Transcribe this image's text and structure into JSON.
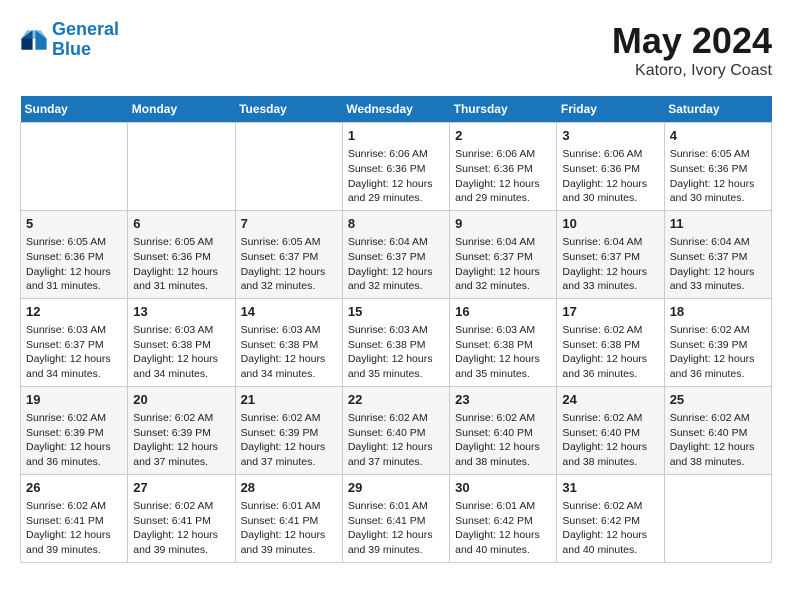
{
  "header": {
    "logo_line1": "General",
    "logo_line2": "Blue",
    "month": "May 2024",
    "location": "Katoro, Ivory Coast"
  },
  "weekdays": [
    "Sunday",
    "Monday",
    "Tuesday",
    "Wednesday",
    "Thursday",
    "Friday",
    "Saturday"
  ],
  "weeks": [
    [
      {
        "day": "",
        "info": ""
      },
      {
        "day": "",
        "info": ""
      },
      {
        "day": "",
        "info": ""
      },
      {
        "day": "1",
        "info": "Sunrise: 6:06 AM\nSunset: 6:36 PM\nDaylight: 12 hours and 29 minutes."
      },
      {
        "day": "2",
        "info": "Sunrise: 6:06 AM\nSunset: 6:36 PM\nDaylight: 12 hours and 29 minutes."
      },
      {
        "day": "3",
        "info": "Sunrise: 6:06 AM\nSunset: 6:36 PM\nDaylight: 12 hours and 30 minutes."
      },
      {
        "day": "4",
        "info": "Sunrise: 6:05 AM\nSunset: 6:36 PM\nDaylight: 12 hours and 30 minutes."
      }
    ],
    [
      {
        "day": "5",
        "info": "Sunrise: 6:05 AM\nSunset: 6:36 PM\nDaylight: 12 hours and 31 minutes."
      },
      {
        "day": "6",
        "info": "Sunrise: 6:05 AM\nSunset: 6:36 PM\nDaylight: 12 hours and 31 minutes."
      },
      {
        "day": "7",
        "info": "Sunrise: 6:05 AM\nSunset: 6:37 PM\nDaylight: 12 hours and 32 minutes."
      },
      {
        "day": "8",
        "info": "Sunrise: 6:04 AM\nSunset: 6:37 PM\nDaylight: 12 hours and 32 minutes."
      },
      {
        "day": "9",
        "info": "Sunrise: 6:04 AM\nSunset: 6:37 PM\nDaylight: 12 hours and 32 minutes."
      },
      {
        "day": "10",
        "info": "Sunrise: 6:04 AM\nSunset: 6:37 PM\nDaylight: 12 hours and 33 minutes."
      },
      {
        "day": "11",
        "info": "Sunrise: 6:04 AM\nSunset: 6:37 PM\nDaylight: 12 hours and 33 minutes."
      }
    ],
    [
      {
        "day": "12",
        "info": "Sunrise: 6:03 AM\nSunset: 6:37 PM\nDaylight: 12 hours and 34 minutes."
      },
      {
        "day": "13",
        "info": "Sunrise: 6:03 AM\nSunset: 6:38 PM\nDaylight: 12 hours and 34 minutes."
      },
      {
        "day": "14",
        "info": "Sunrise: 6:03 AM\nSunset: 6:38 PM\nDaylight: 12 hours and 34 minutes."
      },
      {
        "day": "15",
        "info": "Sunrise: 6:03 AM\nSunset: 6:38 PM\nDaylight: 12 hours and 35 minutes."
      },
      {
        "day": "16",
        "info": "Sunrise: 6:03 AM\nSunset: 6:38 PM\nDaylight: 12 hours and 35 minutes."
      },
      {
        "day": "17",
        "info": "Sunrise: 6:02 AM\nSunset: 6:38 PM\nDaylight: 12 hours and 36 minutes."
      },
      {
        "day": "18",
        "info": "Sunrise: 6:02 AM\nSunset: 6:39 PM\nDaylight: 12 hours and 36 minutes."
      }
    ],
    [
      {
        "day": "19",
        "info": "Sunrise: 6:02 AM\nSunset: 6:39 PM\nDaylight: 12 hours and 36 minutes."
      },
      {
        "day": "20",
        "info": "Sunrise: 6:02 AM\nSunset: 6:39 PM\nDaylight: 12 hours and 37 minutes."
      },
      {
        "day": "21",
        "info": "Sunrise: 6:02 AM\nSunset: 6:39 PM\nDaylight: 12 hours and 37 minutes."
      },
      {
        "day": "22",
        "info": "Sunrise: 6:02 AM\nSunset: 6:40 PM\nDaylight: 12 hours and 37 minutes."
      },
      {
        "day": "23",
        "info": "Sunrise: 6:02 AM\nSunset: 6:40 PM\nDaylight: 12 hours and 38 minutes."
      },
      {
        "day": "24",
        "info": "Sunrise: 6:02 AM\nSunset: 6:40 PM\nDaylight: 12 hours and 38 minutes."
      },
      {
        "day": "25",
        "info": "Sunrise: 6:02 AM\nSunset: 6:40 PM\nDaylight: 12 hours and 38 minutes."
      }
    ],
    [
      {
        "day": "26",
        "info": "Sunrise: 6:02 AM\nSunset: 6:41 PM\nDaylight: 12 hours and 39 minutes."
      },
      {
        "day": "27",
        "info": "Sunrise: 6:02 AM\nSunset: 6:41 PM\nDaylight: 12 hours and 39 minutes."
      },
      {
        "day": "28",
        "info": "Sunrise: 6:01 AM\nSunset: 6:41 PM\nDaylight: 12 hours and 39 minutes."
      },
      {
        "day": "29",
        "info": "Sunrise: 6:01 AM\nSunset: 6:41 PM\nDaylight: 12 hours and 39 minutes."
      },
      {
        "day": "30",
        "info": "Sunrise: 6:01 AM\nSunset: 6:42 PM\nDaylight: 12 hours and 40 minutes."
      },
      {
        "day": "31",
        "info": "Sunrise: 6:02 AM\nSunset: 6:42 PM\nDaylight: 12 hours and 40 minutes."
      },
      {
        "day": "",
        "info": ""
      }
    ]
  ]
}
